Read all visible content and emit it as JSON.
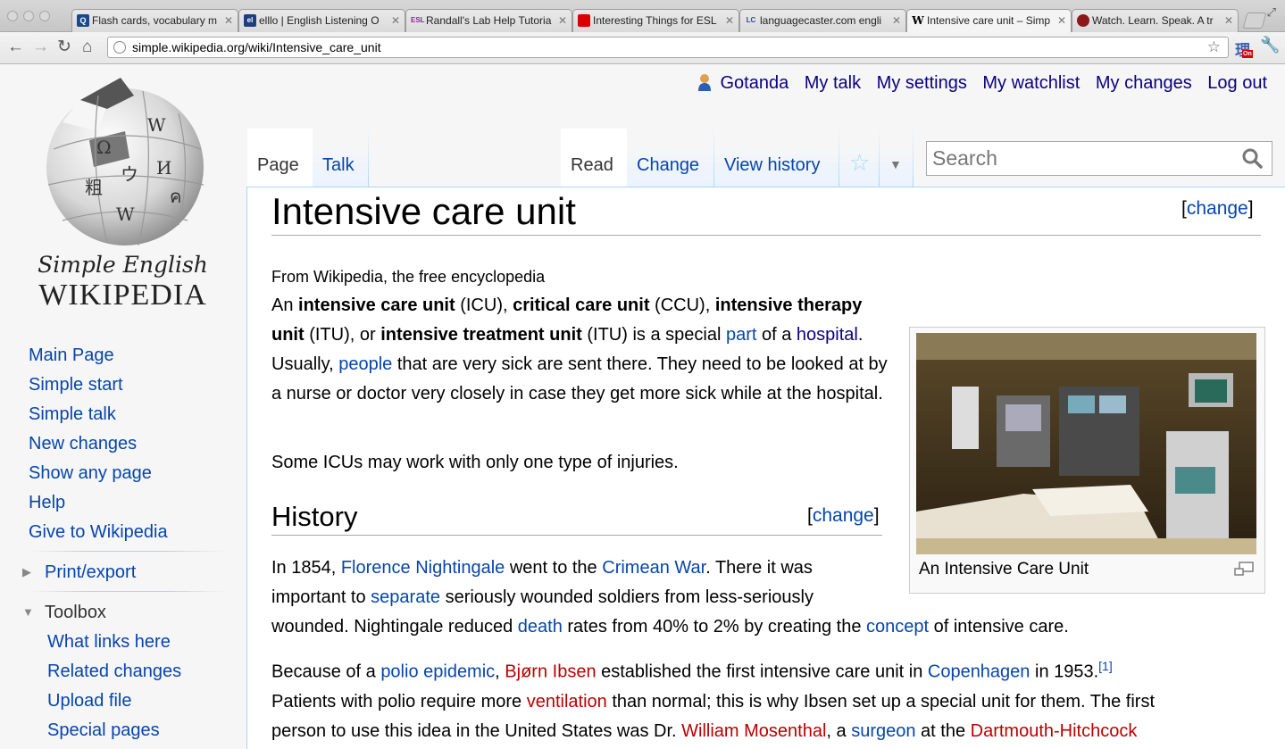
{
  "browser": {
    "tabs": [
      {
        "title": "Flash cards, vocabulary m",
        "favicon_color": "#1a4a8a",
        "favicon_text": "Q"
      },
      {
        "title": "elllo | English Listening O",
        "favicon_color": "#1f3f7f",
        "favicon_text": "el"
      },
      {
        "title": "Randall's Lab Help Tutoria",
        "favicon_color": "#ffffff",
        "favicon_text": "ESL"
      },
      {
        "title": "Interesting Things for ESL",
        "favicon_color": "#dd0000",
        "favicon_text": ""
      },
      {
        "title": "languagecaster.com engli",
        "favicon_color": "#ffffff",
        "favicon_text": "LC"
      },
      {
        "title": "Intensive care unit – Simp",
        "favicon_color": "#ffffff",
        "favicon_text": "W"
      },
      {
        "title": "Watch. Learn. Speak. A tr",
        "favicon_color": "#8a1a1a",
        "favicon_text": ""
      }
    ],
    "url": "simple.wikipedia.org/wiki/Intensive_care_unit"
  },
  "logo": {
    "line1": "Simple English",
    "line2": "WIKIPEDIA"
  },
  "personal": {
    "username": "Gotanda",
    "links": [
      "My talk",
      "My settings",
      "My watchlist",
      "My changes",
      "Log out"
    ]
  },
  "sidebar": {
    "nav": [
      "Main Page",
      "Simple start",
      "Simple talk",
      "New changes",
      "Show any page",
      "Help",
      "Give to Wikipedia"
    ],
    "print_export": "Print/export",
    "toolbox": "Toolbox",
    "toolbox_items": [
      "What links here",
      "Related changes",
      "Upload file",
      "Special pages"
    ]
  },
  "tabs": {
    "page": "Page",
    "talk": "Talk",
    "read": "Read",
    "change": "Change",
    "history": "View history"
  },
  "search": {
    "placeholder": "Search"
  },
  "article": {
    "title": "Intensive care unit",
    "edit_label": "change",
    "tagline": "From Wikipedia, the free encyclopedia",
    "p2": "Some ICUs may work with only one type of injuries.",
    "history_heading": "History",
    "caption": "An Intensive Care Unit",
    "ref": "[1]"
  },
  "colors": {
    "link": "#0645ad",
    "redlink": "#ba0000",
    "visited": "#0b0080",
    "border": "#a7d7f9"
  }
}
